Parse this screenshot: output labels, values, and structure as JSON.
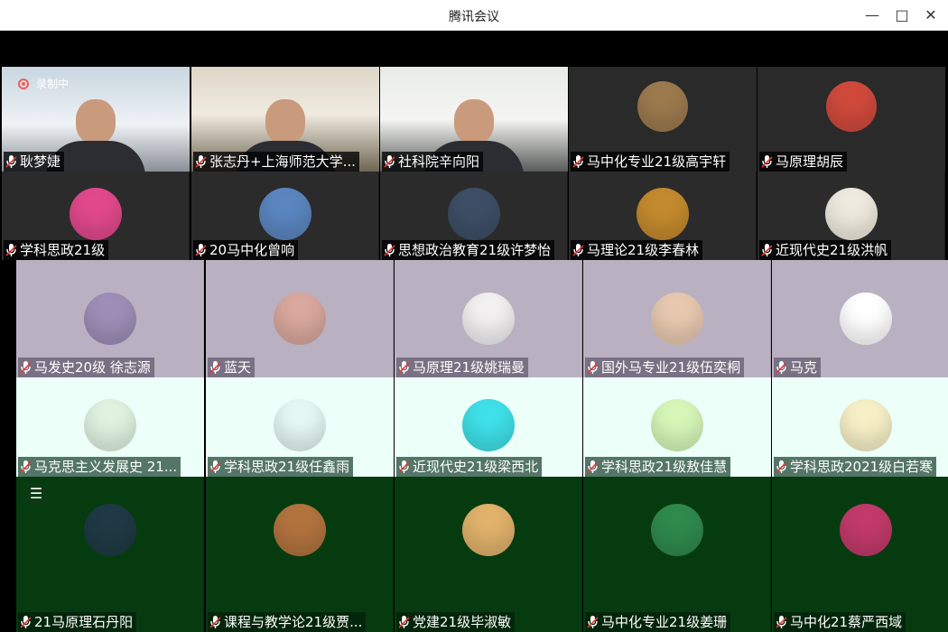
{
  "window": {
    "title": "腾讯会议"
  },
  "recording": {
    "label": "录制中"
  },
  "colors": {
    "row1": "#2a2a2a",
    "row2": "#2b2b2b",
    "row3": "#b9b1c1",
    "row4": "#ecfff8",
    "row5": "#063b10",
    "accent_rec": "#f25b5b"
  },
  "participants_row1": [
    {
      "name": "耿梦婕",
      "type": "video",
      "scene": "office"
    },
    {
      "name": "张志丹+上海师范大学...",
      "type": "video",
      "scene": "bookshelf"
    },
    {
      "name": "社科院辛向阳",
      "type": "video",
      "scene": "office-plant"
    },
    {
      "name": "马中化专业21级高宇轩",
      "type": "avatar",
      "avatar_color": "#9c7a4e"
    },
    {
      "name": "马原理胡辰",
      "type": "avatar",
      "avatar_color": "#d04a3c"
    }
  ],
  "participants_row2": [
    {
      "name": "学科思政21级",
      "avatar_color": "#e1498c"
    },
    {
      "name": "20马中化曾响",
      "avatar_color": "#5b86c0"
    },
    {
      "name": "思想政治教育21级许梦怡",
      "avatar_color": "#3d4f66"
    },
    {
      "name": "马理论21级李春林",
      "avatar_color": "#c48a2e"
    },
    {
      "name": "近现代史21级洪帆",
      "avatar_color": "#efeadf"
    }
  ],
  "participants_row3": [
    {
      "name": "马发史20级 徐志源",
      "avatar_color": "#9e8fb8"
    },
    {
      "name": "蓝天",
      "avatar_color": "#d9a89e"
    },
    {
      "name": "马原理21级姚瑞曼",
      "avatar_color": "#f2f0f0"
    },
    {
      "name": "国外马专业21级伍奕桐",
      "avatar_color": "#e8c9b0"
    },
    {
      "name": "马克",
      "avatar_color": "#ffffff"
    }
  ],
  "participants_row4": [
    {
      "name": "马克思主义发展史 21...",
      "avatar_color": "#dff3e0"
    },
    {
      "name": "学科思政21级任鑫雨",
      "avatar_color": "#e4f7f3"
    },
    {
      "name": "近现代史21级梁西北",
      "avatar_color": "#3fe0e8"
    },
    {
      "name": "学科思政21级敖佳慧",
      "avatar_color": "#d7f7b9"
    },
    {
      "name": "学科思政2021级白若寒",
      "avatar_color": "#f7f0c7"
    }
  ],
  "participants_row5": [
    {
      "name": "21马原理石丹阳",
      "avatar_color": "#1f3a44"
    },
    {
      "name": "课程与教学论21级贾...",
      "avatar_color": "#b2733f"
    },
    {
      "name": "党建21级毕淑敏",
      "avatar_color": "#e0b26a"
    },
    {
      "name": "马中化专业21级姜珊",
      "avatar_color": "#2f8a4c"
    },
    {
      "name": "马中化21蔡严西域",
      "avatar_color": "#c23a6a"
    }
  ],
  "menu": {
    "label": "☰"
  },
  "icons": {
    "minimize": "minimize-icon",
    "maximize": "maximize-icon",
    "close": "close-icon",
    "mic": "mic-icon",
    "menu": "menu-icon"
  }
}
